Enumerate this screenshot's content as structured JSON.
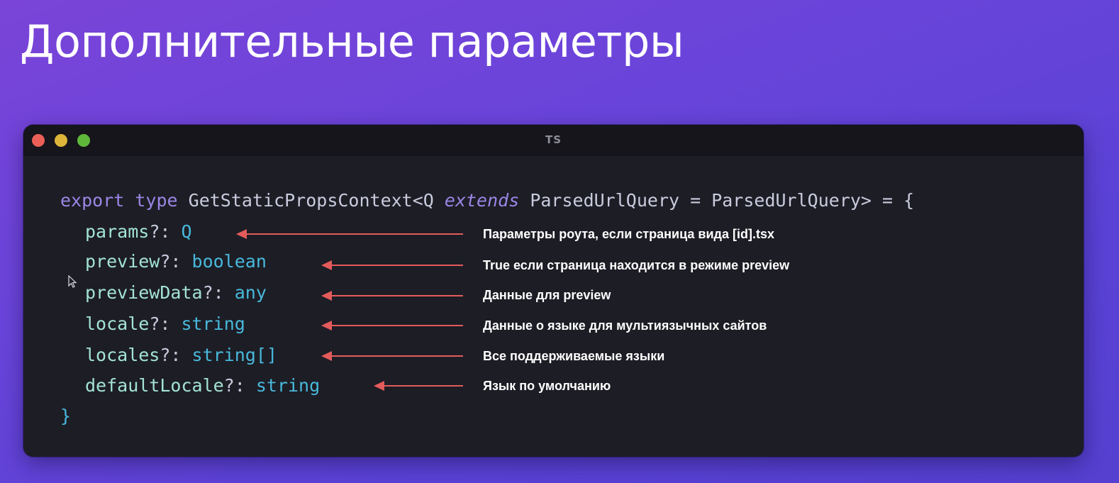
{
  "slide": {
    "title": "Дополнительные параметры"
  },
  "window": {
    "title": "TS",
    "controls": [
      "close",
      "minimize",
      "maximize"
    ]
  },
  "code": {
    "line1": {
      "export": "export",
      "type": "type",
      "name": "GetStaticPropsContext<Q",
      "extends": "extends",
      "rest": "ParsedUrlQuery = ParsedUrlQuery> = {"
    },
    "props": [
      {
        "name": "params",
        "type": "Q",
        "note": "Параметры роута, если страница вида [id].tsx"
      },
      {
        "name": "preview",
        "type": "boolean",
        "note": "True если страница находится в режиме preview"
      },
      {
        "name": "previewData",
        "type": "any",
        "note": "Данные для preview"
      },
      {
        "name": "locale",
        "type": "string",
        "note": "Данные о языке для мультиязычных сайтов"
      },
      {
        "name": "locales",
        "type": "string[]",
        "note": "Все поддерживаемые языки"
      },
      {
        "name": "defaultLocale",
        "type": "string",
        "note": "Язык по умолчанию"
      }
    ],
    "optional_marker": "?:",
    "closing": "}"
  },
  "colors": {
    "background": "#6a44da",
    "editor_bg": "#1d1d25",
    "keyword": "#9b86e6",
    "property": "#a3e3d6",
    "type": "#48b9dc",
    "arrow": "#e35b5b"
  }
}
